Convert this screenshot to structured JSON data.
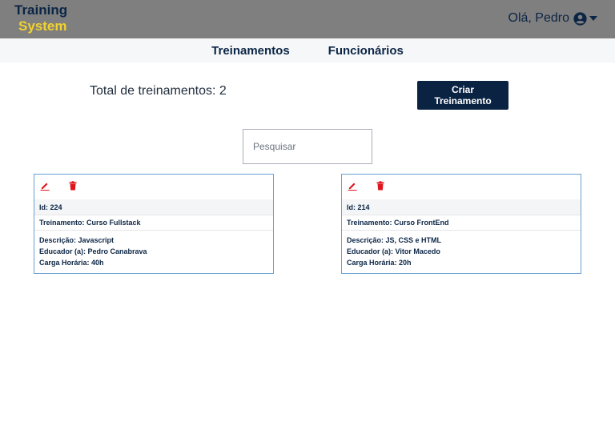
{
  "header": {
    "logo_line1": "Training",
    "logo_line2": "System",
    "greeting": "Olá, Pedro"
  },
  "nav": {
    "items": [
      {
        "label": "Treinamentos"
      },
      {
        "label": "Funcionários"
      }
    ]
  },
  "main": {
    "total_text": "Total de treinamentos: 2",
    "create_button_label": "Criar Treinamento",
    "search_placeholder": "Pesquisar"
  },
  "trainings": [
    {
      "id_text": "Id: 224",
      "name_text": "Treinamento: Curso Fullstack",
      "description_text": "Descrição: Javascript",
      "educator_text": "Educador (a): Pedro Canabrava",
      "hours_text": "Carga Horária: 40h"
    },
    {
      "id_text": "Id: 214",
      "name_text": "Treinamento: Curso FrontEnd",
      "description_text": "Descrição: JS, CSS e HTML",
      "educator_text": "Educador (a): Vitor Macedo",
      "hours_text": "Carga Horária: 20h"
    }
  ],
  "icons": {
    "edit": "pencil-icon",
    "delete": "trash-icon",
    "user": "user-circle-icon",
    "dropdown": "caret-down-icon"
  },
  "colors": {
    "header_bg": "#7f7f7f",
    "brand_navy": "#0b2545",
    "brand_yellow": "#f2d22e",
    "button_bg": "#0a2342",
    "action_red": "#e0141c",
    "card_border": "#6aa0d0"
  }
}
